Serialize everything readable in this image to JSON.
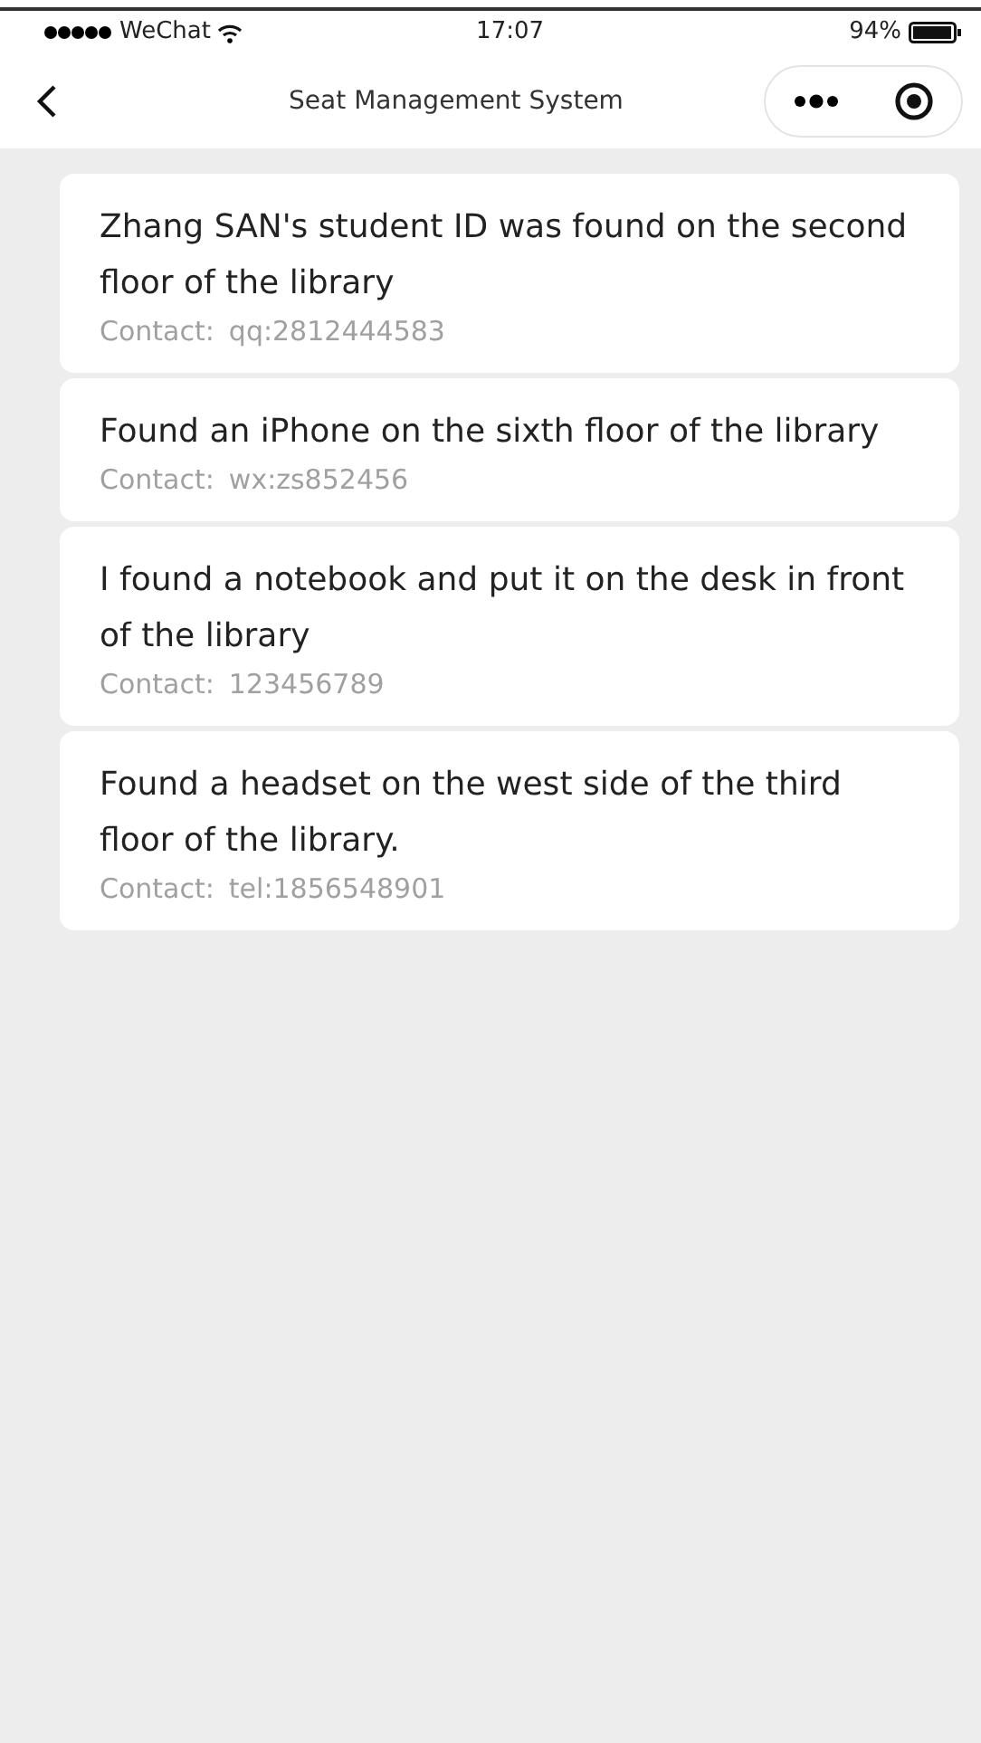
{
  "status_bar": {
    "carrier": "WeChat",
    "time": "17:07",
    "battery": "94%"
  },
  "nav_bar": {
    "title": "Seat Management System"
  },
  "items": [
    {
      "description": "Zhang SAN's student ID was found on the second floor of the library",
      "contact_label": "Contact:",
      "contact": "qq:2812444583"
    },
    {
      "description": "Found an iPhone on the sixth floor of the library",
      "contact_label": "Contact:",
      "contact": "wx:zs852456"
    },
    {
      "description": "I found a notebook and put it on the desk in front of the library",
      "contact_label": "Contact:",
      "contact": "123456789"
    },
    {
      "description": "Found a headset on the west side of the third floor of the library.",
      "contact_label": "Contact:",
      "contact": "tel:1856548901"
    }
  ]
}
